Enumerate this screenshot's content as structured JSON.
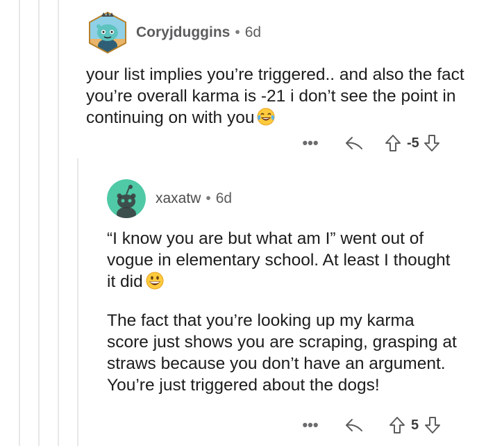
{
  "thread": {
    "comments": [
      {
        "author": "Coryjduggins",
        "separator": "•",
        "age": "6d",
        "avatar_icon": "snoo-avatar-icon",
        "paragraphs": [
          "your list implies you’re triggered.. and also the fact you’re overall karma is -21 i don’t see the point in continuing on with you"
        ],
        "emoji": "tears-of-joy-emoji",
        "actions": {
          "more_label": "•••",
          "score": "-5"
        }
      },
      {
        "author": "xaxatw",
        "separator": "•",
        "age": "6d",
        "avatar_icon": "default-snoo-avatar-icon",
        "paragraphs": [
          "“I know you are but what am I” went out of vogue in elementary school.  At least I thought it did",
          "The fact that you’re looking up my karma score just shows you are scraping, grasping at straws because you don’t have an argument. You’re just triggered about the dogs!"
        ],
        "emoji": "grinning-face-emoji",
        "actions": {
          "more_label": "•••",
          "score": "5"
        }
      }
    ]
  },
  "colors": {
    "text": "#1c1c1c",
    "meta": "#5c5c5e",
    "thread_line": "#e7e7e9",
    "avatar_teal": "#4fc9a6"
  }
}
